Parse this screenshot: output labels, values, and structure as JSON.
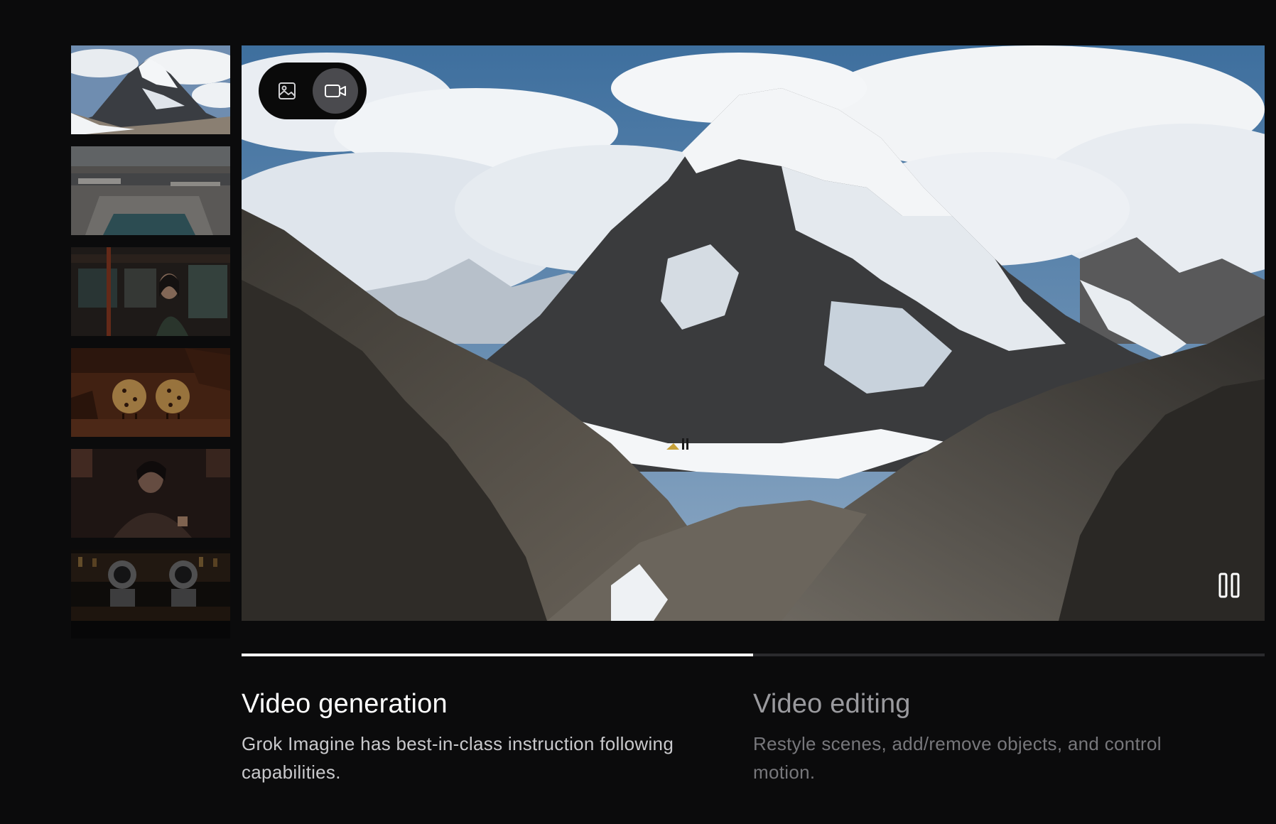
{
  "thumbnails": [
    {
      "name": "thumbnail-mountain",
      "selected": true
    },
    {
      "name": "thumbnail-rooftop-pool",
      "selected": false
    },
    {
      "name": "thumbnail-bus-passenger",
      "selected": false
    },
    {
      "name": "thumbnail-cookies",
      "selected": false
    },
    {
      "name": "thumbnail-portrait",
      "selected": false
    },
    {
      "name": "thumbnail-robots-bar",
      "selected": false
    }
  ],
  "mode_toggle": {
    "image_icon": "image-icon",
    "video_icon": "video-camera-icon",
    "active": "video"
  },
  "player": {
    "pause_icon": "pause-icon"
  },
  "tabs": [
    {
      "title": "Video generation",
      "description": "Grok Imagine has best-in-class instruction following capabilities.",
      "progress": 1.0,
      "active": true
    },
    {
      "title": "Video editing",
      "description": "Restyle scenes, add/remove objects, and control motion.",
      "progress": 0.0,
      "active": false
    }
  ],
  "colors": {
    "background": "#0b0b0c",
    "progress_active": "#ffffff",
    "progress_track": "#2a2a2d"
  }
}
